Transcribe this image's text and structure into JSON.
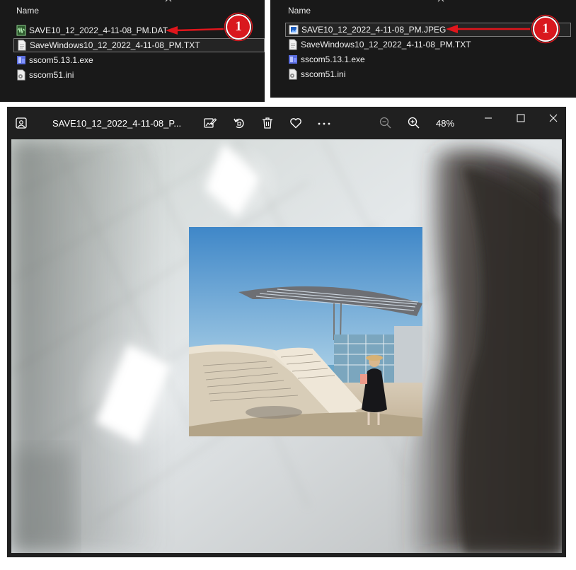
{
  "explorer_left": {
    "column_header": "Name",
    "files": [
      {
        "name": "SAVE10_12_2022_4-11-08_PM.DAT",
        "icon": "audio-wave-file-icon"
      },
      {
        "name": "SaveWindows10_12_2022_4-11-08_PM.TXT",
        "icon": "text-file-icon"
      },
      {
        "name": "sscom5.13.1.exe",
        "icon": "exe-file-icon"
      },
      {
        "name": "sscom51.ini",
        "icon": "ini-file-icon"
      }
    ],
    "callout": "1"
  },
  "explorer_right": {
    "column_header": "Name",
    "files": [
      {
        "name": "SAVE10_12_2022_4-11-08_PM.JPEG",
        "icon": "image-file-icon"
      },
      {
        "name": "SaveWindows10_12_2022_4-11-08_PM.TXT",
        "icon": "text-file-icon"
      },
      {
        "name": "sscom5.13.1.exe",
        "icon": "exe-file-icon"
      },
      {
        "name": "sscom51.ini",
        "icon": "ini-file-icon"
      }
    ],
    "callout": "1"
  },
  "photo_viewer": {
    "title": "SAVE10_12_2022_4-11-08_P...",
    "zoom": "48%",
    "toolbar_icons": [
      "edit-image-icon",
      "rotate-icon",
      "delete-icon",
      "favorite-icon",
      "more-icon",
      "zoom-out-icon",
      "zoom-in-icon"
    ],
    "window_controls": [
      "minimize-icon",
      "maximize-icon",
      "close-icon"
    ]
  },
  "colors": {
    "explorer_bg": "#191919",
    "viewer_bg": "#202020",
    "callout_red": "#d9181e",
    "arrow_red": "#e0161c"
  }
}
